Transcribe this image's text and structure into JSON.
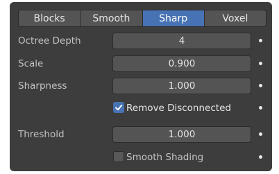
{
  "tabs": [
    {
      "label": "Blocks",
      "active": false
    },
    {
      "label": "Smooth",
      "active": false
    },
    {
      "label": "Sharp",
      "active": true
    },
    {
      "label": "Voxel",
      "active": false
    }
  ],
  "fields": {
    "octree_depth": {
      "label": "Octree Depth",
      "value": "4"
    },
    "scale": {
      "label": "Scale",
      "value": "0.900"
    },
    "sharpness": {
      "label": "Sharpness",
      "value": "1.000"
    },
    "threshold": {
      "label": "Threshold",
      "value": "1.000"
    }
  },
  "checkboxes": {
    "remove_disconnected": {
      "label": "Remove Disconnected",
      "checked": true
    },
    "smooth_shading": {
      "label": "Smooth Shading",
      "checked": false
    }
  },
  "colors": {
    "accent": "#4772b3",
    "panel_bg": "#3d3d3d",
    "field_bg": "#545454"
  }
}
